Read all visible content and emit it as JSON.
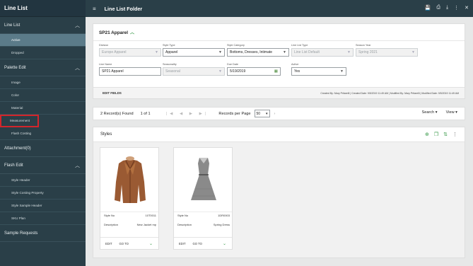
{
  "app": {
    "title": "Line List"
  },
  "sidebar": {
    "sections": [
      {
        "label": "Line List",
        "items": [
          {
            "label": "Active",
            "active": true
          },
          {
            "label": "Dropped"
          }
        ]
      },
      {
        "label": "Palette Edit",
        "items": [
          {
            "label": "Image"
          },
          {
            "label": "Color"
          },
          {
            "label": "Material"
          },
          {
            "label": "Measurement",
            "highlighted": true
          },
          {
            "label": "Flash Costing"
          }
        ]
      },
      {
        "label": "Attachment(0)"
      },
      {
        "label": "Flash Edit",
        "items": [
          {
            "label": "Style Header"
          },
          {
            "label": "Style Costing Property"
          },
          {
            "label": "Style Sample Header"
          },
          {
            "label": "SKU Plan"
          }
        ]
      },
      {
        "label": "Sample Requests"
      }
    ]
  },
  "header": {
    "title": "Line List Folder",
    "icons": [
      "save-icon",
      "print-icon",
      "download-icon",
      "more-icon",
      "close-icon"
    ]
  },
  "form": {
    "title": "SP21 Apparel",
    "fields": [
      {
        "label": "Division",
        "value": "Europe Apparel",
        "disabled": true
      },
      {
        "label": "Style Type",
        "value": "Apparel"
      },
      {
        "label": "Style Category",
        "value": "Bottoms, Dresses, Intimate"
      },
      {
        "label": "Line List Type",
        "value": "Line List Default",
        "disabled": true
      },
      {
        "label": "Season Year",
        "value": "Spring 2021",
        "disabled": true
      },
      {
        "label": "Line Name",
        "value": "SP21 Apparel"
      },
      {
        "label": "Seasonality",
        "value": "Seasonal",
        "disabled": true
      },
      {
        "label": "Due Date",
        "value": "5/19/2019"
      },
      {
        "label": "Active",
        "value": "Yes"
      }
    ],
    "edit_fields": "EDIT FIELDS",
    "audit": "Created By: Mary Pritarelli | Created Date: 9/5/2019 11:49 AM | Modified By: Mary Pritarelli | Modified Date: 9/5/2019 11:49 AM"
  },
  "records": {
    "found": "2 Record(s) Found",
    "page": "1 of 1",
    "rpp_label": "Records per Page",
    "rpp_value": "50",
    "search": "Search",
    "view": "View"
  },
  "styles": {
    "title": "Styles",
    "tiles": [
      {
        "style_no_label": "Style No",
        "style_no": "10T0011",
        "desc_label": "Description",
        "desc": "New Jacket mp",
        "edit": "EDIT",
        "goto": "GO TO"
      },
      {
        "style_no_label": "Style No",
        "style_no": "1DR0003",
        "desc_label": "Description",
        "desc": "Spring Dress",
        "edit": "EDIT",
        "goto": "GO TO"
      }
    ]
  },
  "colors": {
    "sidebar": "#2a3f48",
    "accent": "#3a9a4a",
    "highlight": "#d3252b"
  }
}
